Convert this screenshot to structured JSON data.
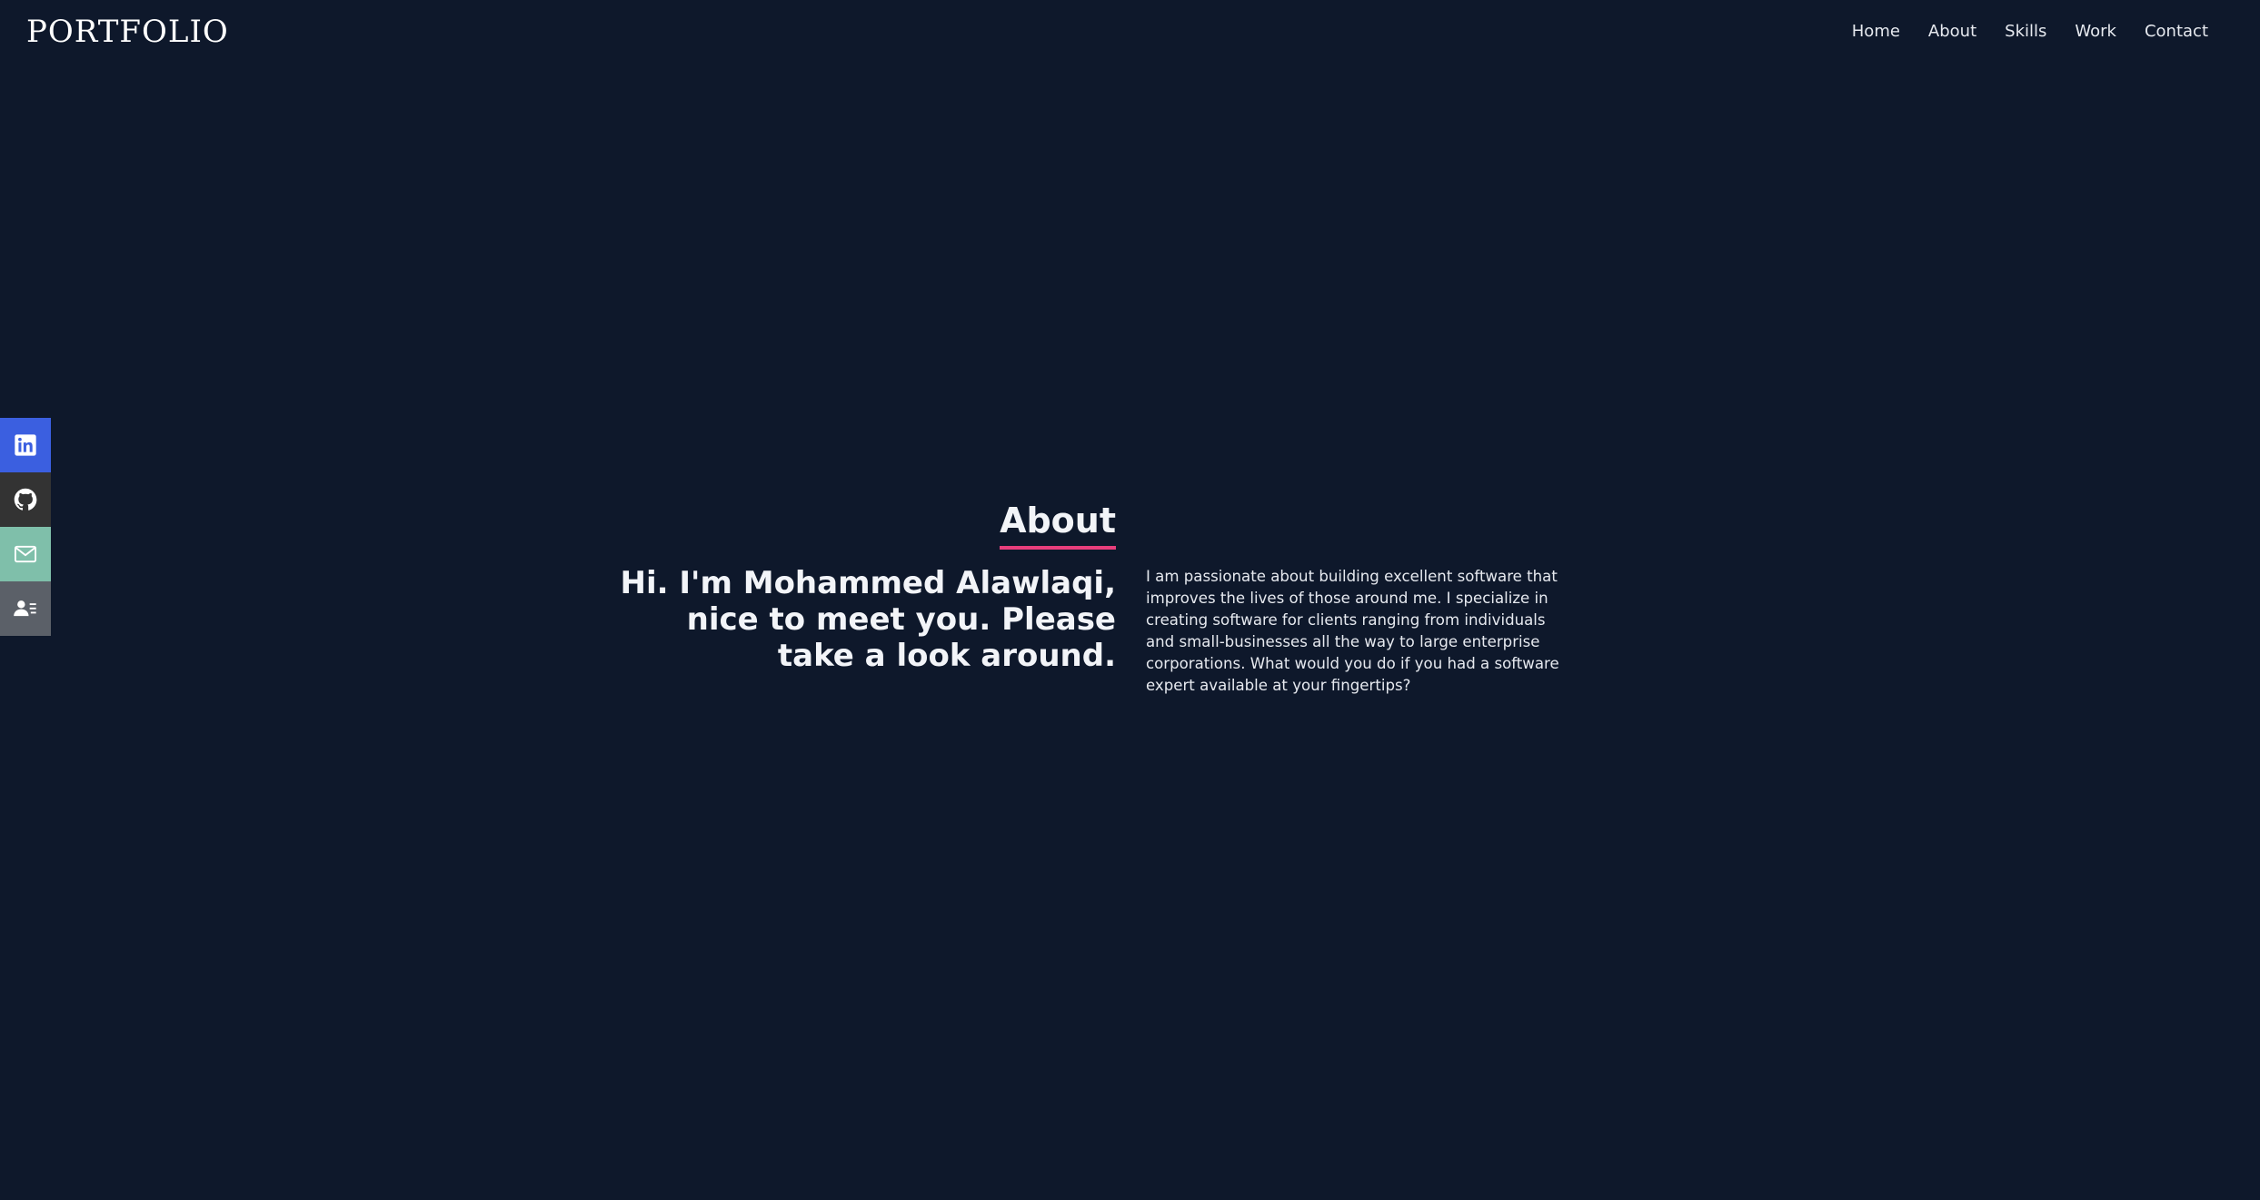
{
  "header": {
    "logo": "PORTFOLIO",
    "nav": [
      "Home",
      "About",
      "Skills",
      "Work",
      "Contact"
    ]
  },
  "social": {
    "items": [
      {
        "name": "linkedin",
        "icon": "linkedin-icon",
        "bg": "#3b5fe0"
      },
      {
        "name": "github",
        "icon": "github-icon",
        "bg": "#333333"
      },
      {
        "name": "email",
        "icon": "mail-icon",
        "bg": "#7fbfaa"
      },
      {
        "name": "resume",
        "icon": "resume-icon",
        "bg": "#5b6068"
      }
    ]
  },
  "about": {
    "title": "About",
    "greeting": "Hi. I'm Mohammed Alawlaqi, nice to meet you. Please take a look around.",
    "bio": "I am passionate about building excellent software that improves the lives of those around me. I specialize in creating software for clients ranging from individuals and small-businesses all the way to large enterprise corporations. What would you do if you had a software expert available at your fingertips?"
  },
  "colors": {
    "background": "#0e182b",
    "accent": "#e83e7c"
  }
}
